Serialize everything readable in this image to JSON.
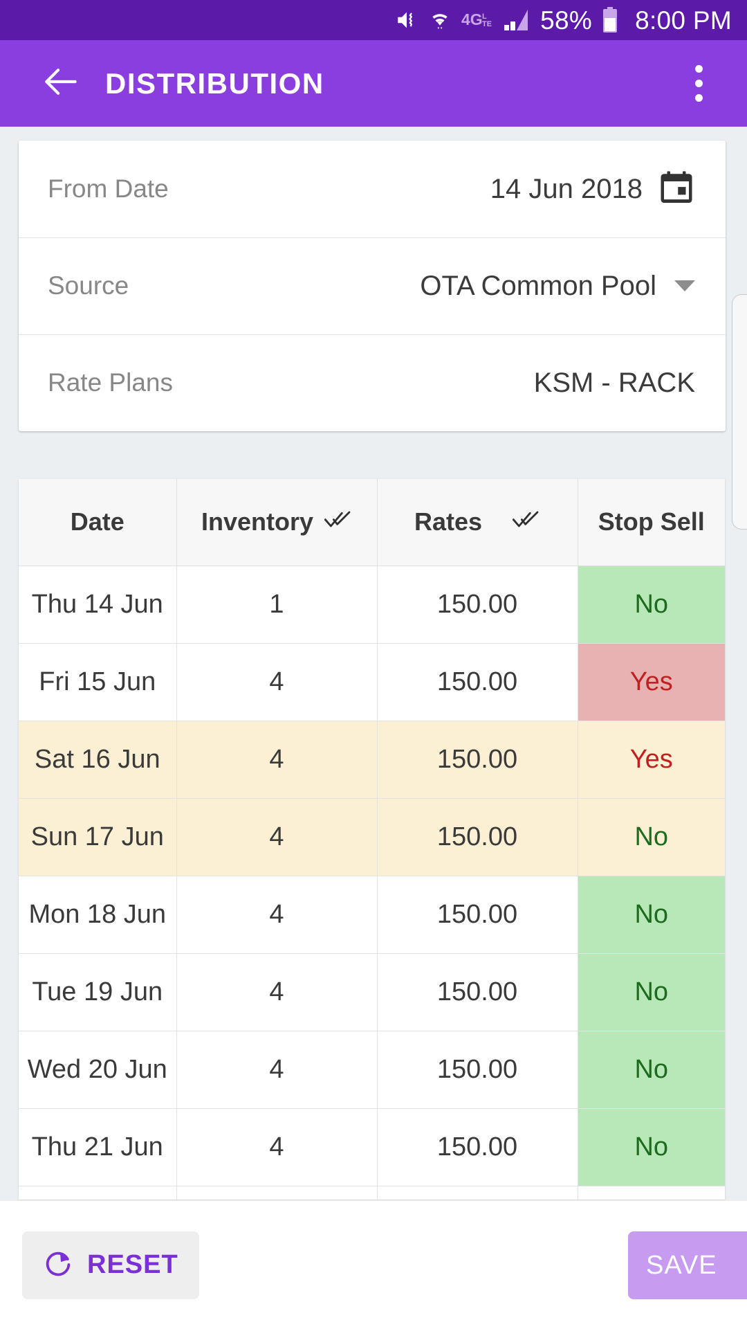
{
  "status_bar": {
    "battery_percent": "58%",
    "time": "8:00 PM",
    "network": "4G LTE",
    "icons": [
      "mute-vibrate-icon",
      "wifi-icon",
      "4glte-icon",
      "signal-bars-icon",
      "battery-icon"
    ],
    "background_color": "#5b1aa8"
  },
  "app_bar": {
    "title": "DISTRIBUTION",
    "back_icon": "arrow-left-icon",
    "overflow_icon": "more-vert-icon",
    "background_color": "#8a3ee0"
  },
  "form": {
    "rows": [
      {
        "label": "From Date",
        "value": "14 Jun 2018",
        "trailing_icon": "calendar-icon"
      },
      {
        "label": "Source",
        "value": "OTA Common Pool",
        "trailing_icon": "chevron-down-icon"
      },
      {
        "label": "Rate Plans",
        "value": "KSM - RACK",
        "trailing_icon": ""
      }
    ]
  },
  "table": {
    "headers": [
      {
        "label": "Date",
        "icon": ""
      },
      {
        "label": "Inventory",
        "icon": "double-check-icon"
      },
      {
        "label": "Rates",
        "icon": "double-check-icon"
      },
      {
        "label": "Stop Sell",
        "icon": ""
      }
    ],
    "rows": [
      {
        "date": "Thu 14 Jun",
        "inventory": "1",
        "rate": "150.00",
        "stop_sell": "No",
        "weekend": false
      },
      {
        "date": "Fri 15 Jun",
        "inventory": "4",
        "rate": "150.00",
        "stop_sell": "Yes",
        "weekend": false
      },
      {
        "date": "Sat 16 Jun",
        "inventory": "4",
        "rate": "150.00",
        "stop_sell": "Yes",
        "weekend": true
      },
      {
        "date": "Sun 17 Jun",
        "inventory": "4",
        "rate": "150.00",
        "stop_sell": "No",
        "weekend": true
      },
      {
        "date": "Mon 18 Jun",
        "inventory": "4",
        "rate": "150.00",
        "stop_sell": "No",
        "weekend": false
      },
      {
        "date": "Tue 19 Jun",
        "inventory": "4",
        "rate": "150.00",
        "stop_sell": "No",
        "weekend": false
      },
      {
        "date": "Wed 20 Jun",
        "inventory": "4",
        "rate": "150.00",
        "stop_sell": "No",
        "weekend": false
      },
      {
        "date": "Thu 21 Jun",
        "inventory": "4",
        "rate": "150.00",
        "stop_sell": "No",
        "weekend": false
      },
      {
        "date": "",
        "inventory": "",
        "rate": "",
        "stop_sell": "",
        "weekend": false
      }
    ]
  },
  "bottom_bar": {
    "reset_label": "RESET",
    "reset_icon": "refresh-icon",
    "save_label": "SAVE",
    "accent_color": "#7b2fd6",
    "save_bg_color": "#c69bf0"
  }
}
